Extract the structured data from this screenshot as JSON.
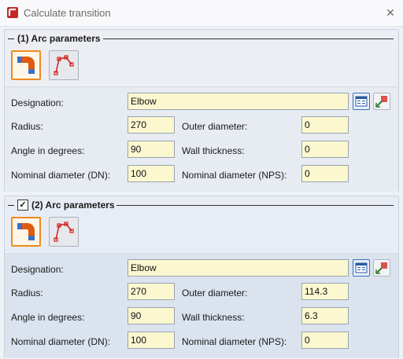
{
  "window": {
    "title": "Calculate transition",
    "close_symbol": "✕"
  },
  "sections": [
    {
      "header": "(1) Arc parameters",
      "has_checkbox": false,
      "designation_label": "Designation:",
      "designation_value": "Elbow",
      "radius_label": "Radius:",
      "radius_value": "270",
      "angle_label": "Angle in degrees:",
      "angle_value": "90",
      "dn_label": "Nominal diameter (DN):",
      "dn_value": "100",
      "outer_label": "Outer diameter:",
      "outer_value": "0",
      "wall_label": "Wall thickness:",
      "wall_value": "0",
      "nps_label": "Nominal diameter (NPS):",
      "nps_value": "0"
    },
    {
      "header": "(2) Arc parameters",
      "has_checkbox": true,
      "checkbox_checked": true,
      "check_symbol": "✓",
      "designation_label": "Designation:",
      "designation_value": "Elbow",
      "radius_label": "Radius:",
      "radius_value": "270",
      "angle_label": "Angle in degrees:",
      "angle_value": "90",
      "dn_label": "Nominal diameter (DN):",
      "dn_value": "100",
      "outer_label": "Outer diameter:",
      "outer_value": "114.3",
      "wall_label": "Wall thickness:",
      "wall_value": "6.3",
      "nps_label": "Nominal diameter (NPS):",
      "nps_value": "0"
    }
  ],
  "icons": {
    "app": "transition-app-icon",
    "arc_button": "pipe-elbow-icon",
    "polyline_button": "polyline-arc-icon",
    "catalog": "catalog-icon",
    "pick": "pick-from-model-icon"
  },
  "colors": {
    "field_bg": "#fbf8d0",
    "active_border": "#f08a1c",
    "accent_blue": "#3a6fb7"
  }
}
